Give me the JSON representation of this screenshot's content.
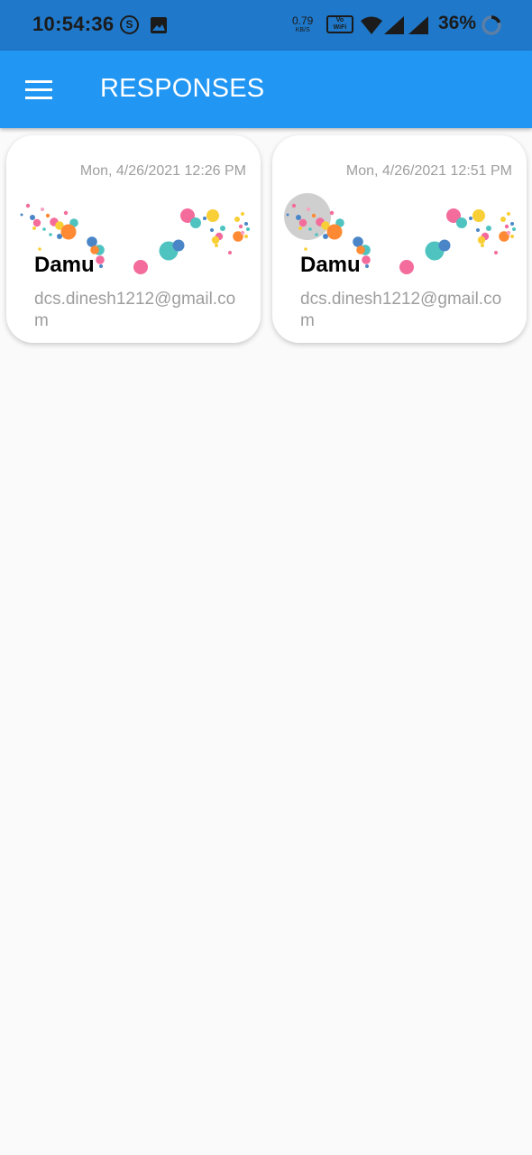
{
  "status_bar": {
    "time": "10:54:36",
    "s_badge": "S",
    "speed_value": "0.79",
    "speed_unit": "KB/S",
    "vowifi_line1": "Vo",
    "vowifi_line2": "WiFi",
    "battery": "36%"
  },
  "app_bar": {
    "title": "RESPONSES",
    "background": "#2196f3"
  },
  "responses": [
    {
      "date": "Mon, 4/26/2021 12:26 PM",
      "name": "Damu",
      "email": "dcs.dinesh1212@gmail.com"
    },
    {
      "date": "Mon, 4/26/2021 12:51 PM",
      "name": "Damu",
      "email": "dcs.dinesh1212@gmail.com"
    }
  ],
  "confetti_colors": [
    "#f7a1c0",
    "#f36c9b",
    "#4fc3c0",
    "#ff8a33",
    "#f9cf37",
    "#4a86c7"
  ]
}
